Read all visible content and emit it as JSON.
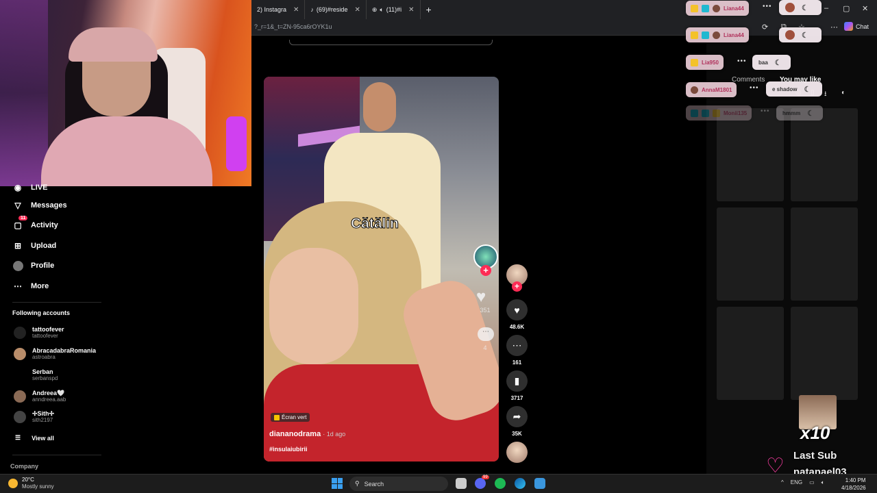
{
  "browser": {
    "tabs": [
      {
        "label": "2) Instagra"
      },
      {
        "label": "(69)#reside"
      },
      {
        "label": "(11)#i"
      }
    ],
    "new_tab_symbol": "+",
    "url": "?_r=1&_t=ZN-95ca6rOYK1u",
    "chat_button": "Chat",
    "window_controls": [
      "–",
      "▢",
      "✕"
    ]
  },
  "sidebar": {
    "live_label": "LIVE",
    "items": [
      {
        "label": "Messages",
        "icon": "paper-plane-icon"
      },
      {
        "label": "Activity",
        "icon": "inbox-icon",
        "badge": "11"
      },
      {
        "label": "Upload",
        "icon": "plus-square-icon"
      },
      {
        "label": "Profile",
        "icon": "avatar-icon"
      },
      {
        "label": "More",
        "icon": "more-dots-icon"
      }
    ],
    "following_title": "Following accounts",
    "accounts": [
      {
        "name": "tattoofever",
        "handle": "tattoofever"
      },
      {
        "name": "AbracadabraRomania",
        "handle": "astroabra"
      },
      {
        "name": "Serban",
        "handle": "serbanspd"
      },
      {
        "name": "Andreea🤍",
        "handle": "anndreea.aab"
      },
      {
        "name": "✢Sith✢",
        "handle": "sith2197"
      }
    ],
    "view_all": "View all",
    "company": "Company"
  },
  "video": {
    "caption_overlay": "Cătălin",
    "green_screen": "Écran vert",
    "author": "diananodrama",
    "posted": "· 1d ago",
    "hashtag": "#insulaiubirii",
    "inner_counts": {
      "likes": "351",
      "comments": "4"
    }
  },
  "actions": {
    "likes": "48.6K",
    "comments": "161",
    "saves": "3717",
    "shares": "35K"
  },
  "right_panel": {
    "tab_comments": "Comments",
    "tab_you_may_like": "You may like"
  },
  "chat_overlay": {
    "users": [
      {
        "name": "Liana44"
      },
      {
        "name": "Liana44"
      },
      {
        "name": "Lia950"
      },
      {
        "name": "AnnaM1801"
      },
      {
        "name": "Monii135"
      }
    ],
    "messages": [
      {
        "text": "baa"
      },
      {
        "text": "e shadow"
      },
      {
        "text": "hmmm"
      }
    ]
  },
  "sub_alert": {
    "multiplier": "x10",
    "label": "Last Sub",
    "name": "natanael03"
  },
  "taskbar": {
    "temperature": "20°C",
    "weather": "Mostly sunny",
    "search_placeholder": "Search",
    "notification_badge": "99",
    "language": "ENG",
    "time": "1:40 PM",
    "date": "4/18/2026"
  },
  "colors": {
    "accent": "#fe2c55",
    "chat_pill": "#ebcdd7",
    "sub_heart": "#ff3ea5"
  }
}
